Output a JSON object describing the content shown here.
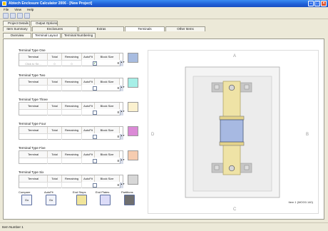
{
  "window": {
    "title": "Abtech Enclosure Calculator 2006 - [New Project]"
  },
  "menu": [
    "File",
    "View",
    "Help"
  ],
  "tabs": {
    "top": [
      "Project Details",
      "Output Options"
    ],
    "second": [
      "Item Summary",
      "Enclosures",
      "Extras",
      "Terminals",
      "Other Items"
    ],
    "third": [
      "Overview",
      "Terminal Layout",
      "Terminal Numbering"
    ]
  },
  "grid_headers": [
    "Terminal",
    "Total",
    "Remaining",
    "AutoFit",
    "Block Size"
  ],
  "terminal_types": [
    {
      "label": "Terminal Type One",
      "placeholder": "Click to Se...",
      "total": "0",
      "remaining": "0",
      "autofit": true,
      "block_size": "8",
      "color": "#a8bce0"
    },
    {
      "label": "Terminal Type Two",
      "placeholder": "",
      "total": "",
      "remaining": "",
      "autofit": false,
      "block_size": "8",
      "color": "#a6efe7"
    },
    {
      "label": "Terminal Type Three",
      "placeholder": "",
      "total": "",
      "remaining": "",
      "autofit": false,
      "block_size": "8",
      "color": "#fbf1cf"
    },
    {
      "label": "Terminal Type Four",
      "placeholder": "",
      "total": "",
      "remaining": "",
      "autofit": false,
      "block_size": "8",
      "color": "#db8ad6"
    },
    {
      "label": "Terminal Type Five",
      "placeholder": "",
      "total": "",
      "remaining": "",
      "autofit": false,
      "block_size": "8",
      "color": "#f6ccb0"
    },
    {
      "label": "Terminal Type Six",
      "placeholder": "",
      "total": "",
      "remaining": "",
      "autofit": false,
      "block_size": "8",
      "color": "#d7d7d7"
    }
  ],
  "bottom_tools": {
    "compare_label": "Compare",
    "compare_btn": "Go",
    "autofit_label": "AutoFit",
    "autofit_btn": "Go",
    "endstops_label": "End Stops",
    "endplates_label": "End Plates",
    "partitions_label": "Partitions",
    "endstops_color": "#f1e59a",
    "endplates_color": "#dcdcf8",
    "partitions_color": "#6f6f6f"
  },
  "preview": {
    "side_a": "A",
    "side_b": "B",
    "side_c": "C",
    "side_d": "D",
    "item_label": "Item 1 (MOG0.140)"
  },
  "status": "Item Number 1"
}
